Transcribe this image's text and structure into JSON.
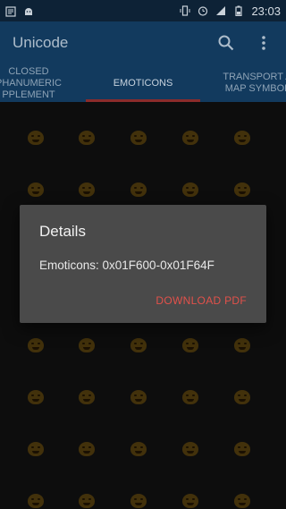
{
  "status_bar": {
    "time": "23:03",
    "icons": [
      "notification-icon",
      "android-icon",
      "vibrate-icon",
      "alarm-icon",
      "signal-icon",
      "battery-icon"
    ]
  },
  "app_bar": {
    "title": "Unicode",
    "actions": [
      "search-icon",
      "more-vert-icon"
    ]
  },
  "tabs": [
    {
      "label": "CLOSED\nPHANUMERIC\nPPLEMENT",
      "active": false
    },
    {
      "label": "EMOTICONS",
      "active": true
    },
    {
      "label": "TRANSPORT A\nMAP SYMBOL",
      "active": false
    }
  ],
  "dialog": {
    "title": "Details",
    "body": "Emoticons: 0x01F600-0x01F64F",
    "button": "DOWNLOAD PDF"
  },
  "colors": {
    "status_bar": "#0d2236",
    "app_bar": "#123a5e",
    "tab_indicator": "#8b2b2b",
    "dialog_bg": "#4a4a4a",
    "accent_button": "#e2514a",
    "emoji": "#6b4f12"
  },
  "grid": {
    "icon": "emoji-icon",
    "columns": 5,
    "visible_rows": 8
  }
}
